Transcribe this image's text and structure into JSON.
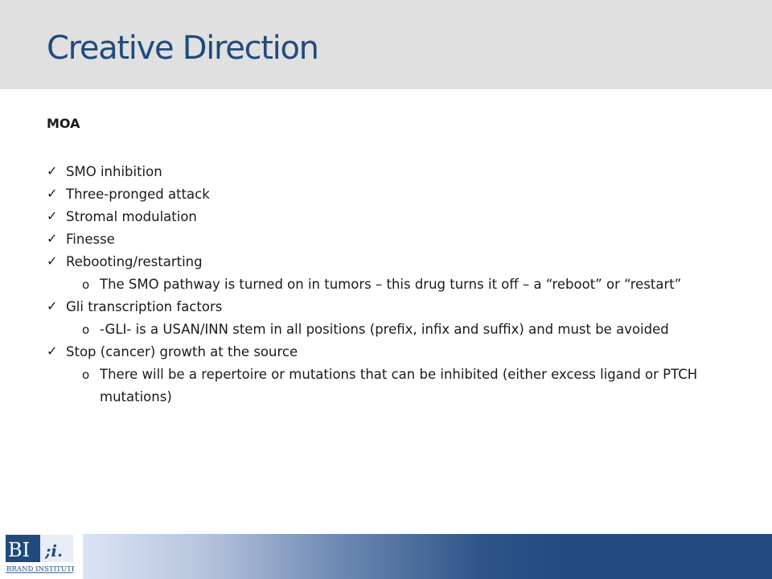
{
  "slide": {
    "title": "Creative Direction",
    "heading": "MOA",
    "check_glyph": "✓",
    "sub_glyph": "o",
    "items": [
      {
        "text": "SMO inhibition",
        "subs": []
      },
      {
        "text": "Three-pronged  attack",
        "subs": []
      },
      {
        "text": "Stromal modulation",
        "subs": []
      },
      {
        "text": "Finesse",
        "subs": []
      },
      {
        "text": "Rebooting/restarting",
        "subs": [
          "The SMO pathway is turned on in tumors – this drug turns it off – a “reboot” or “restart”"
        ]
      },
      {
        "text": "Gli transcription factors",
        "subs": [
          "-GLI- is a USAN/INN stem in all positions (prefix, infix and suffix) and must be avoided"
        ]
      },
      {
        "text": "Stop (cancer) growth at the source",
        "subs": [
          "There will be a repertoire or mutations that can be inhibited (either excess ligand or PTCH mutations)"
        ]
      }
    ]
  },
  "logo": {
    "mark": "BI",
    "accent": ";i.",
    "name": "BRAND INSTITUTE"
  },
  "colors": {
    "title": "#1f4a7e",
    "header_bg": "#e0e0e0",
    "footer_dark": "#224a7f",
    "logo_bg": "#1f4a7e"
  }
}
